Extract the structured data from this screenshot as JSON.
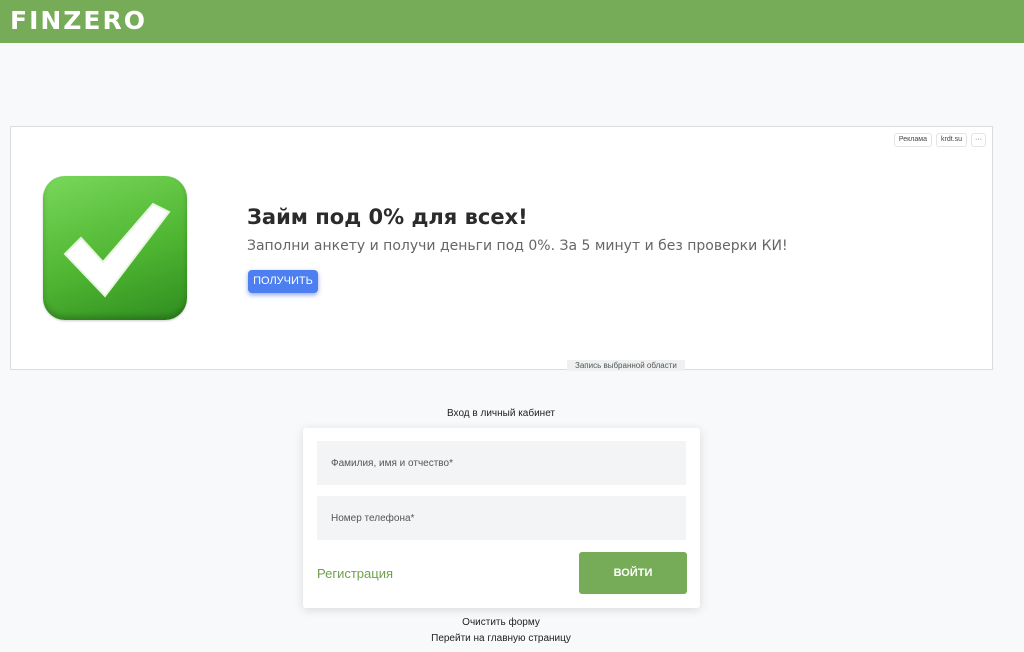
{
  "header": {
    "logo": "FINZERO",
    "color": "#76ab57"
  },
  "ad": {
    "tags": [
      "Реклама",
      "krdt.su",
      "···"
    ],
    "image_icon": "checkmark-icon",
    "title": "Займ под 0% для всех!",
    "description": "Заполни анкету и получи деньги под 0%. За 5 минут и без проверки КИ!",
    "button_label": "ПОЛУЧИТЬ",
    "record_label": "Запись выбранной области"
  },
  "login": {
    "title": "Вход в личный кабинет",
    "name_placeholder": "Фамилия, имя и отчество*",
    "name_value": "",
    "phone_placeholder": "Номер телефона*",
    "phone_value": "",
    "register_label": "Регистрация",
    "submit_label": "ВОЙТИ"
  },
  "links": {
    "clear_form": "Очистить форму",
    "home": "Перейти на главную страницу"
  },
  "colors": {
    "accent": "#76ab57",
    "ad_button": "#4d7ff0"
  }
}
